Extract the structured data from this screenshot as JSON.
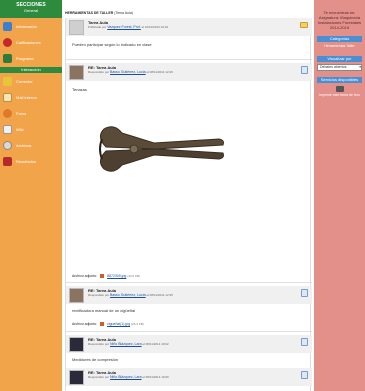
{
  "sidebar": {
    "header_title": "SECCIONES",
    "header_subtitle": "General",
    "items": [
      {
        "label": "Información",
        "icon": "info-icon"
      },
      {
        "label": "Calificaciones",
        "icon": "grades-icon"
      },
      {
        "label": "Programa",
        "icon": "program-icon"
      }
    ],
    "section_label": "Interacción",
    "items2": [
      {
        "label": "Corrector",
        "icon": "corrector-icon"
      },
      {
        "label": "Mail interno",
        "icon": "mail-icon"
      },
      {
        "label": "Foros",
        "icon": "forums-icon"
      },
      {
        "label": "Wiki",
        "icon": "wiki-icon"
      },
      {
        "label": "Archivos",
        "icon": "files-icon"
      },
      {
        "label": "Resultados",
        "icon": "results-icon"
      }
    ]
  },
  "topbar": {
    "title": "HERRAMIENTAS DE TALLER",
    "subtitle": "(Tema Aula)"
  },
  "right_panel": {
    "title": "Te encuentras en: Asignatura: Maquinaria Instalaciones Forestales 2014-2015",
    "categories_header": "Categorías",
    "categories_value": "Herramientas Taller",
    "visualize_header": "Visualizar por",
    "visualize_select": "Debates abiertos",
    "services_header": "Servicios disponibles",
    "print_label": "Imprimir este tema de foro"
  },
  "posts": [
    {
      "title": "Tarea Aula",
      "meta_prefix": "Publicado por",
      "author": "Vazquez Forest, Prof.",
      "date": "el 10/10/2014 10:10",
      "body": "Pueden participar según lo indicado en clase",
      "avatar": "silhouette"
    },
    {
      "title": "RE: Tarea Aula",
      "meta_prefix": "Respondido por",
      "author": "Basso Gutiérrez, Lucía",
      "date": "el 08/11/2014 12:29",
      "body": "Tenazas",
      "attachment_label": "Archivo adjunto:",
      "attachment_file": "8872309.jpg",
      "attachment_size": "(33.0 KB)",
      "avatar": "photo"
    },
    {
      "title": "RE: Tarea Aula",
      "meta_prefix": "Respondido por",
      "author": "Basso Gutiérrez, Lucía",
      "date": "el 08/11/2014 12:35",
      "body": "rectificadora manual de un cigüeñal",
      "attachment_label": "Archivo adjunto:",
      "attachment_file": "cigueñal(1).jpg",
      "attachment_size": "(26.3 KB)",
      "avatar": "photo"
    },
    {
      "title": "RE: Tarea Aula",
      "meta_prefix": "Respondido por",
      "author": "Niño Blázquez, Lara",
      "date": "el 08/11/2014 19:02",
      "body": "Medidores de compresión",
      "attachment_label": "Archivo adjunto:",
      "attachment_file": "DSCF5107.jpg",
      "attachment_size": "(90.6 KB)",
      "avatar": "photo"
    },
    {
      "title": "RE: Tarea Aula",
      "meta_prefix": "Respondido por",
      "author": "Niño Blázquez, Lara",
      "date": "el 08/11/2014 19:09",
      "avatar": "photo"
    }
  ]
}
